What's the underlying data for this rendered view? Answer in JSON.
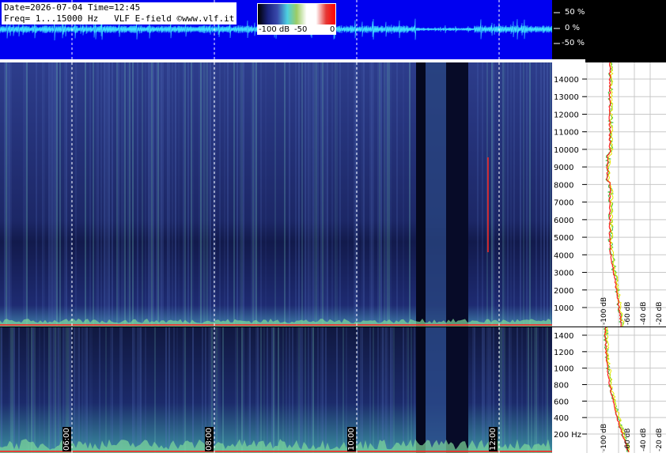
{
  "header": {
    "date_time": "Date=2026-07-04 Time=12:45",
    "freq_line": "Freq= 1...15000 Hz   VLF E-field ©www.vlf.it"
  },
  "colorbar": {
    "labels": [
      "-100 dB",
      "-50",
      "0"
    ],
    "stops": [
      "#000000",
      "#1a237e",
      "#3949ab",
      "#4dd0e1",
      "#9ccc65",
      "#ffffff",
      "#ffffff",
      "#e53935",
      "#ff0000"
    ]
  },
  "waveform_scale": {
    "labels": [
      "50 %",
      "0 %",
      "-50 %"
    ]
  },
  "upper_freq_axis": {
    "labels": [
      "14000",
      "13000",
      "12000",
      "11000",
      "10000",
      "9000",
      "8000",
      "7000",
      "6000",
      "5000",
      "4000",
      "3000",
      "2000",
      "1000"
    ]
  },
  "lower_freq_axis": {
    "labels": [
      "1400",
      "1200",
      "1000",
      "800",
      "600",
      "400",
      "200 Hz"
    ]
  },
  "spectrum_db": {
    "labels": [
      "-100 dB",
      "-60 dB",
      "-40 dB",
      "-20 dB"
    ]
  },
  "time_axis": {
    "labels": [
      "06:00",
      "08:00",
      "10:00",
      "12:00"
    ]
  },
  "colors": {
    "waveform_bg": "#0000f0",
    "waveform_trace": "#40e0ff",
    "spectrogram_dark": "#0b1238",
    "spectrogram_mid": "#2d3d8c",
    "spectrogram_bright": "#7fd8c8",
    "red_trace": "#ff2020",
    "yellow_trace": "#ffff40"
  }
}
